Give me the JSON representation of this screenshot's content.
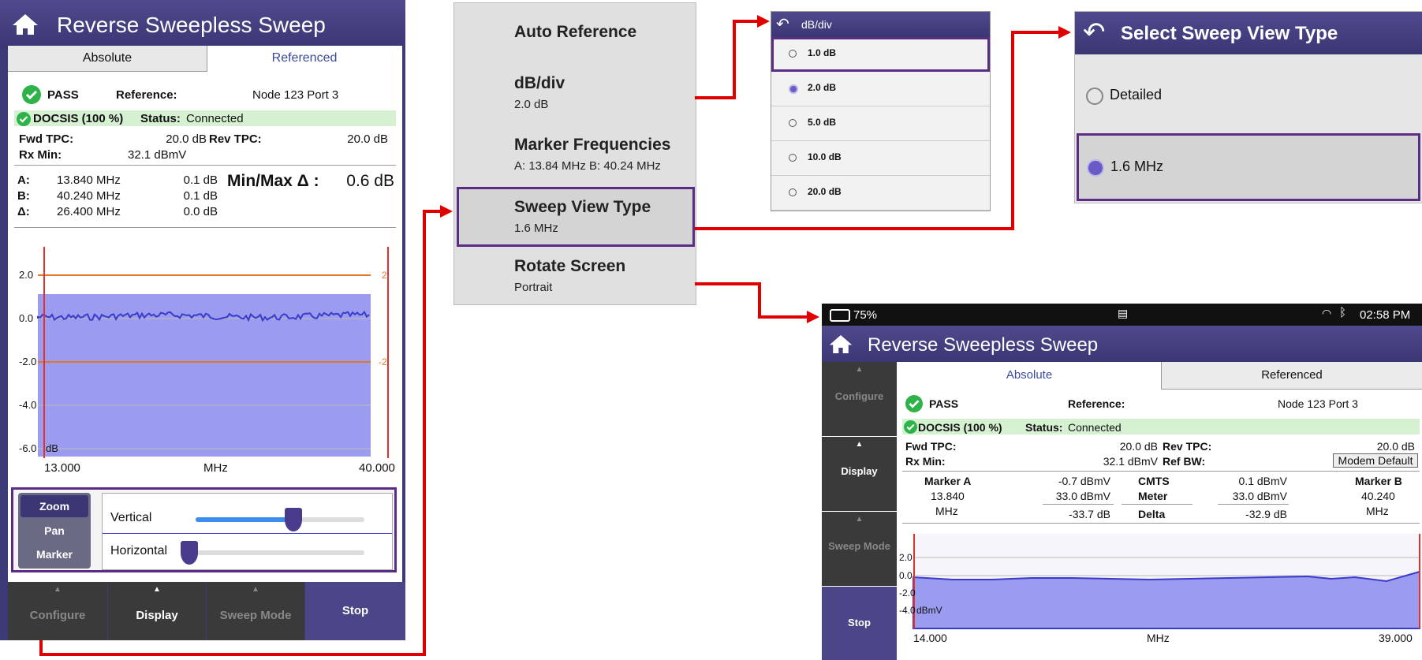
{
  "app_title": "Reverse Sweepless Sweep",
  "tabs": {
    "absolute": "Absolute",
    "referenced": "Referenced"
  },
  "left": {
    "pass": "PASS",
    "reference_label": "Reference:",
    "reference_value": "Node 123 Port 3",
    "docsis": "DOCSIS (100 %)",
    "status_label": "Status:",
    "status_value": "Connected",
    "fwd_tpc_label": "Fwd TPC:",
    "fwd_tpc_value": "20.0 dB",
    "rev_tpc_label": "Rev TPC:",
    "rev_tpc_value": "20.0 dB",
    "rx_min_label": "Rx Min:",
    "rx_min_value": "32.1 dBmV",
    "markers": [
      {
        "label": "A:",
        "freq": "13.840 MHz",
        "db": "0.1 dB"
      },
      {
        "label": "B:",
        "freq": "40.240 MHz",
        "db": "0.1 dB"
      },
      {
        "label": "Δ:",
        "freq": "26.400 MHz",
        "db": "0.0 dB"
      }
    ],
    "minmax_label": "Min/Max Δ :",
    "minmax_value": "0.6 dB",
    "y_ticks": [
      "2.0",
      "0.0",
      "-2.0",
      "-4.0",
      "-6.0"
    ],
    "y_unit": "dB",
    "limit_tag_top": "2",
    "limit_tag_bottom": "-2",
    "x_start": "13.000",
    "x_unit": "MHz",
    "x_end": "40.000",
    "ctrl": {
      "zoom": "Zoom",
      "pan": "Pan",
      "marker": "Marker",
      "vertical": "Vertical",
      "horizontal": "Horizontal"
    },
    "vertical_level": 0.58,
    "horizontal_level": 0.0,
    "bottom_buttons": {
      "configure": "Configure",
      "display": "Display",
      "sweep_mode": "Sweep Mode",
      "stop": "Stop"
    }
  },
  "menu": {
    "items": [
      {
        "title": "Auto Reference",
        "sub": ""
      },
      {
        "title": "dB/div",
        "sub": "2.0 dB"
      },
      {
        "title": "Marker Frequencies",
        "sub": "A: 13.84 MHz  B: 40.24 MHz"
      },
      {
        "title": "Sweep View Type",
        "sub": "1.6 MHz"
      },
      {
        "title": "Rotate Screen",
        "sub": "Portrait"
      }
    ]
  },
  "dbdiv": {
    "title": "dB/div",
    "options": [
      "1.0 dB",
      "2.0 dB",
      "5.0 dB",
      "10.0 dB",
      "20.0 dB"
    ],
    "selected": "2.0 dB"
  },
  "sweep_view": {
    "title": "Select Sweep View Type",
    "options": [
      "Detailed",
      "1.6 MHz"
    ],
    "selected": "1.6 MHz"
  },
  "landscape": {
    "battery": "75%",
    "time": "02:58 PM",
    "title": "Reverse Sweepless Sweep",
    "side_buttons": {
      "configure": "Configure",
      "display": "Display",
      "sweep_mode": "Sweep Mode",
      "stop": "Stop"
    },
    "pass": "PASS",
    "reference_label": "Reference:",
    "reference_value": "Node 123 Port 3",
    "docsis": "DOCSIS (100 %)",
    "status_label": "Status:",
    "status_value": "Connected",
    "fwd_tpc_label": "Fwd TPC:",
    "fwd_tpc_value": "20.0 dB",
    "rev_tpc_label": "Rev TPC:",
    "rev_tpc_value": "20.0 dB",
    "rx_min_label": "Rx Min:",
    "rx_min_value": "32.1 dBmV",
    "ref_bw_label": "Ref BW:",
    "ref_bw_button": "Modem Default",
    "marker_a": "Marker A",
    "marker_a_freq": "13.840",
    "marker_a_unit": "MHz",
    "marker_b": "Marker B",
    "marker_b_freq": "40.240",
    "marker_b_unit": "MHz",
    "cmts": "CMTS",
    "meter": "Meter",
    "delta": "Delta",
    "a_cmts": "-0.7 dBmV",
    "a_meter": "33.0 dBmV",
    "a_delta": "-33.7 dB",
    "b_cmts": "0.1 dBmV",
    "b_meter": "33.0 dBmV",
    "b_delta": "-32.9 dB",
    "y_ticks": [
      "2.0",
      "0.0",
      "-2.0",
      "-4.0"
    ],
    "y_unit": "dBmV",
    "x_start": "14.000",
    "x_unit": "MHz",
    "x_end": "39.000"
  },
  "colors": {
    "purple": "#4a4688",
    "highlight": "#5a2d82",
    "green": "#2db34a",
    "fill": "#9b9cf0",
    "trace": "#3a3acc",
    "limit": "#e0782a",
    "marker": "#e03030",
    "arrow": "#e00000"
  }
}
